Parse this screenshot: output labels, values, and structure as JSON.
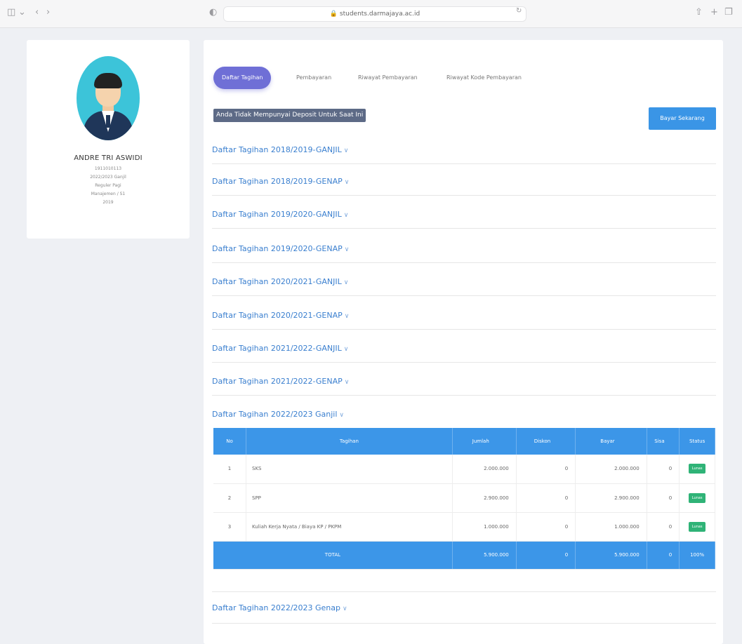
{
  "browser": {
    "url": "students.darmajaya.ac.id"
  },
  "profile": {
    "name": "ANDRE TRI ASWIDI",
    "lines": [
      "1911010113",
      "2022/2023 Ganjil",
      "Reguler Pagi",
      "Manajemen / S1",
      "2019"
    ]
  },
  "tabs": [
    {
      "label": "Daftar Tagihan",
      "active": true
    },
    {
      "label": "Pembayaran",
      "active": false
    },
    {
      "label": "Riwayat Pembayaran",
      "active": false
    },
    {
      "label": "Riwayat Kode Pembayaran",
      "active": false
    }
  ],
  "notice": "Anda Tidak Mempunyai Deposit Untuk Saat Ini",
  "pay_button": "Bayar Sekarang",
  "accordions": [
    "Daftar Tagihan 2018/2019-GANJIL",
    "Daftar Tagihan 2018/2019-GENAP",
    "Daftar Tagihan 2019/2020-GANJIL",
    "Daftar Tagihan 2019/2020-GENAP",
    "Daftar Tagihan 2020/2021-GANJIL",
    "Daftar Tagihan 2020/2021-GENAP",
    "Daftar Tagihan 2021/2022-GANJIL",
    "Daftar Tagihan 2021/2022-GENAP",
    "Daftar Tagihan 2022/2023 Ganjil"
  ],
  "accordion_last": "Daftar Tagihan 2022/2023 Genap",
  "chevron": "∨",
  "table": {
    "headers": [
      "No",
      "Tagihan",
      "Jumlah",
      "Diskon",
      "Bayar",
      "Sisa",
      "Status"
    ],
    "rows": [
      {
        "no": "1",
        "tagihan": "SKS",
        "jumlah": "2.000.000",
        "diskon": "0",
        "bayar": "2.000.000",
        "sisa": "0",
        "status": "Lunas"
      },
      {
        "no": "2",
        "tagihan": "SPP",
        "jumlah": "2.900.000",
        "diskon": "0",
        "bayar": "2.900.000",
        "sisa": "0",
        "status": "Lunas"
      },
      {
        "no": "3",
        "tagihan": "Kuliah Kerja Nyata / Biaya KP / PKPM",
        "jumlah": "1.000.000",
        "diskon": "0",
        "bayar": "1.000.000",
        "sisa": "0",
        "status": "Lunas"
      }
    ],
    "total": {
      "label": "TOTAL",
      "jumlah": "5.900.000",
      "diskon": "0",
      "bayar": "5.900.000",
      "sisa": "0",
      "status": "100%"
    }
  },
  "colors": {
    "tab_active": "#6f6fd6",
    "primary_blue": "#3c96e8",
    "badge_green": "#2fb377",
    "accordion_text": "#3a7fcf"
  }
}
